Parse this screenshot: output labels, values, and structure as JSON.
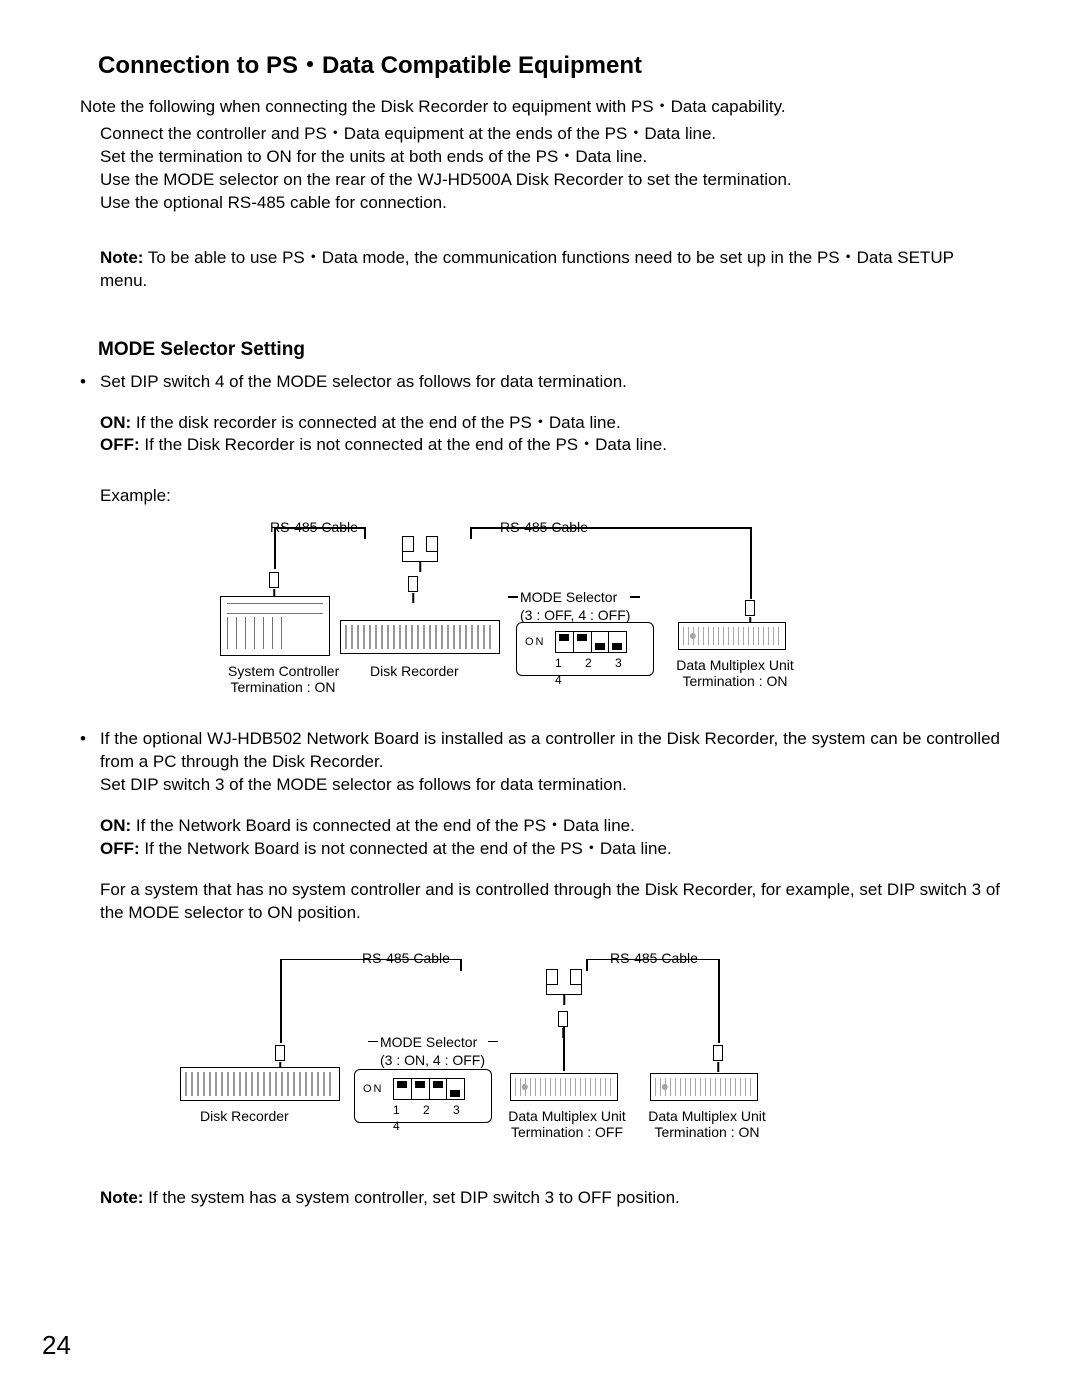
{
  "heading": "Connection to PS・Data Compatible Equipment",
  "intro": "Note the following when connecting the Disk Recorder to equipment with PS・Data capability.",
  "bullets_intro": [
    "Connect the controller and PS・Data equipment at the ends of the PS・Data line.",
    "Set the termination to ON for the units at both ends of the PS・Data line.",
    "Use the MODE selector on the rear of the WJ-HD500A Disk Recorder to set the termination.",
    "Use the optional RS-485 cable for connection."
  ],
  "note_label": "Note:",
  "note1": " To be able to use PS・Data mode, the communication functions need to be set up in the PS・Data SETUP menu.",
  "sub_heading": "MODE Selector Setting",
  "sec1_bullet": "Set DIP switch 4 of the MODE selector as follows for data termination.",
  "on_label": "ON:",
  "off_label": "OFF:",
  "sec1_on": " If the disk recorder is connected at the end of the PS・Data line.",
  "sec1_off": " If the Disk Recorder is not connected at the end of the PS・Data line.",
  "example_label": "Example:",
  "diag1": {
    "cable_left": "RS-485 Cable",
    "cable_right": "RS-485 Cable",
    "mode_selector": "MODE Selector",
    "mode_setting": "(3 : OFF, 4 : OFF)",
    "dip_on": "ON",
    "dip_nums": "1 2 3 4",
    "controller": "System Controller",
    "controller_term": "Termination : ON",
    "recorder": "Disk Recorder",
    "dmux": "Data Multiplex Unit",
    "dmux_term": "Termination : ON"
  },
  "sec2_bullet": "If the optional WJ-HDB502 Network Board is installed as a controller in the Disk Recorder, the system can be controlled from a PC through the Disk Recorder.",
  "sec2_line2": "Set DIP switch 3 of the MODE selector as follows for data termination.",
  "sec2_on": " If the Network Board is connected at the end of the PS・Data line.",
  "sec2_off": " If the Network Board is not connected at the end of the PS・Data line.",
  "sec2_para": "For a system that has no system controller and is controlled through the Disk Recorder, for example, set DIP switch 3 of the MODE selector to ON position.",
  "diag2": {
    "cable_left": "RS-485 Cable",
    "cable_right": "RS-485 Cable",
    "mode_selector": "MODE Selector",
    "mode_setting": "(3 : ON, 4 : OFF)",
    "dip_on": "ON",
    "dip_nums": "1 2 3 4",
    "recorder": "Disk Recorder",
    "dmux1": "Data Multiplex Unit",
    "dmux1_term": "Termination : OFF",
    "dmux2": "Data Multiplex Unit",
    "dmux2_term": "Termination : ON"
  },
  "note2": " If the system has a system controller, set DIP switch 3 to OFF position.",
  "page": "24"
}
